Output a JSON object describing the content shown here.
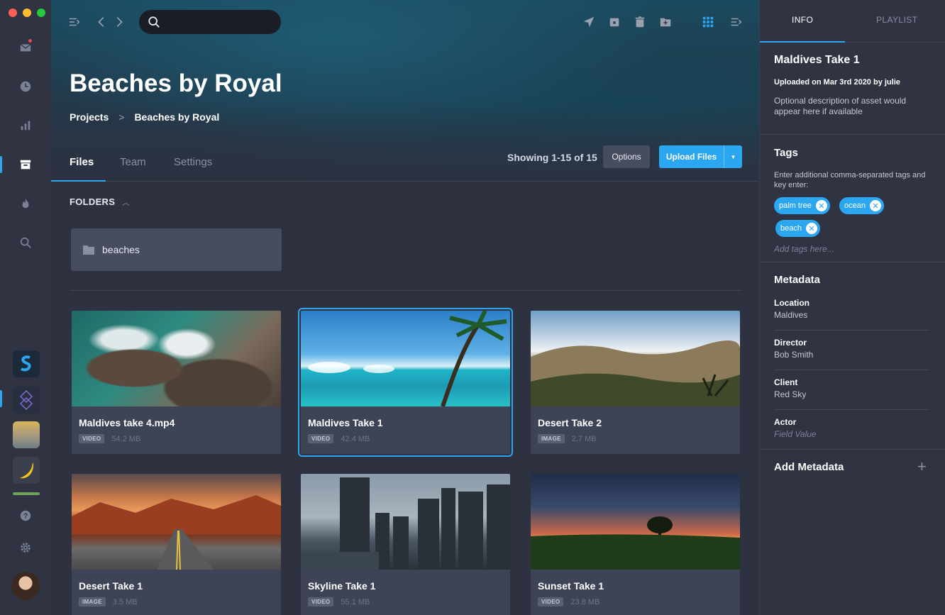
{
  "colors": {
    "accent": "#2ba6f0",
    "close": "#ff5f57",
    "minimize": "#febc2e",
    "maximize": "#28c840"
  },
  "sidebar": {
    "icons": [
      "inbox-icon",
      "clock-icon",
      "bar-chart-icon",
      "archive-icon",
      "flame-icon",
      "search-icon"
    ],
    "bottom_icons": [
      "help-icon",
      "gear-icon"
    ]
  },
  "search": {
    "placeholder": ""
  },
  "header": {
    "title": "Beaches by Royal",
    "breadcrumb": [
      "Projects",
      "Beaches by Royal"
    ],
    "breadcrumb_sep": ">"
  },
  "tabs": [
    "Files",
    "Team",
    "Settings"
  ],
  "toolbar": {
    "showing": "Showing 1-15 of 15",
    "options_label": "Options",
    "upload_label": "Upload Files"
  },
  "folders": {
    "header": "FOLDERS",
    "items": [
      {
        "name": "beaches"
      }
    ]
  },
  "files": [
    {
      "name": "Maldives take 4.mp4",
      "type": "VIDEO",
      "size": "54.2 MB"
    },
    {
      "name": "Maldives Take 1",
      "type": "VIDEO",
      "size": "42.4 MB",
      "selected": true
    },
    {
      "name": "Desert Take 2",
      "type": "IMAGE",
      "size": "2.7 MB"
    },
    {
      "name": "Desert Take 1",
      "type": "IMAGE",
      "size": "3.5 MB"
    },
    {
      "name": "Skyline Take 1",
      "type": "VIDEO",
      "size": "55.1 MB"
    },
    {
      "name": "Sunset Take 1",
      "type": "VIDEO",
      "size": "23.8 MB"
    }
  ],
  "panel": {
    "tabs": [
      "INFO",
      "PLAYLIST"
    ],
    "asset_title": "Maldives Take 1",
    "uploaded": "Uploaded on Mar 3rd 2020 by julie",
    "description": "Optional description of asset would appear here if available",
    "tags": {
      "title": "Tags",
      "hint": "Enter additional comma-separated tags and key enter:",
      "items": [
        "palm tree",
        "ocean",
        "beach"
      ],
      "placeholder": "Add tags here..."
    },
    "metadata": {
      "title": "Metadata",
      "fields": [
        {
          "key": "Location",
          "value": "Maldives"
        },
        {
          "key": "Director",
          "value": "Bob Smith"
        },
        {
          "key": "Client",
          "value": "Red Sky"
        },
        {
          "key": "Actor",
          "value": "Field Value",
          "placeholder": true
        }
      ]
    },
    "add_metadata": "Add Metadata",
    "add_metadata_icon": "plus-icon"
  }
}
